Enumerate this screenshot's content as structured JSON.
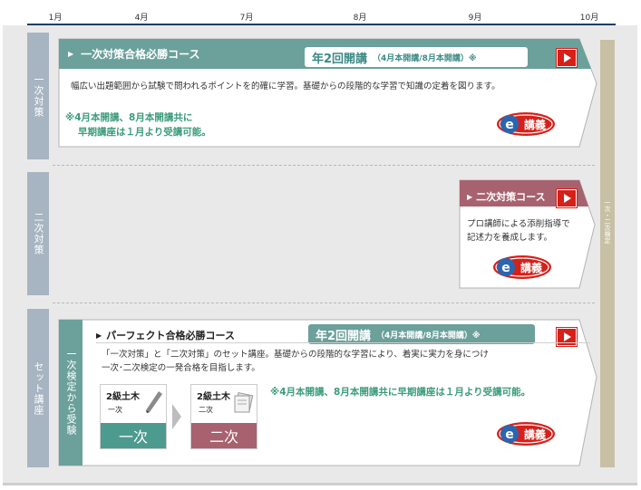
{
  "timeline": {
    "months": [
      "1月",
      "4月",
      "7月",
      "8月",
      "9月",
      "10月"
    ]
  },
  "sections": {
    "first": {
      "side_label": "一次対策",
      "course_title": "一次対策合格必勝コース",
      "badge_main": "年2回開講",
      "badge_sub": "（4月本開講/8月本開講）※",
      "description": "幅広い出題範囲から試験で問われるポイントを的確に学習。基礎からの段階的な学習で知識の定着を図ります。",
      "note_line1": "※4月本開講、8月本開講共に",
      "note_line2": "早期講座は１月より受講可能。"
    },
    "second": {
      "side_label": "二次対策",
      "course_title": "二次対策コース",
      "description_line1": "プロ講師による添削指導で",
      "description_line2": "記述力を養成します。"
    },
    "set": {
      "side_label": "セット講座",
      "inner_label": "一次検定から受験",
      "course_title": "パーフェクト合格必勝コース",
      "badge_main": "年2回開講",
      "badge_sub": "（4月本開講/8月本開講）※",
      "description_line1": "「一次対策」と「二次対策」のセット講座。基礎からの段階的な学習により、着実に実力を身につけ",
      "description_line2": "一次･二次検定の一発合格を目指します。",
      "box1_title": "2級土木",
      "box1_sub": "一次",
      "box1_bar": "一次",
      "box2_title": "2級土木",
      "box2_sub": "二次",
      "box2_bar": "二次",
      "note": "※4月本開講、8月本開講共に早期講座は１月より受講可能。"
    }
  },
  "right_bar_label": "一次・二次検定",
  "logo": {
    "letter": "e",
    "text": "講義"
  },
  "colors": {
    "header_teal": "#6ba09b",
    "badge_text": "#3c8a85",
    "play_red": "#d6201a",
    "second_header": "#a8626f",
    "box1_bar": "#4d9a8f",
    "box2_bar": "#a8626f",
    "side_label_bg": "#a7b4c1",
    "right_bar_bg": "#c7c0a4",
    "timeline_rule": "#1d3f66"
  },
  "icons": [
    "play-icon",
    "triangle-bullet-icon",
    "pencil-icon",
    "documents-icon",
    "e-lecture-logo"
  ]
}
